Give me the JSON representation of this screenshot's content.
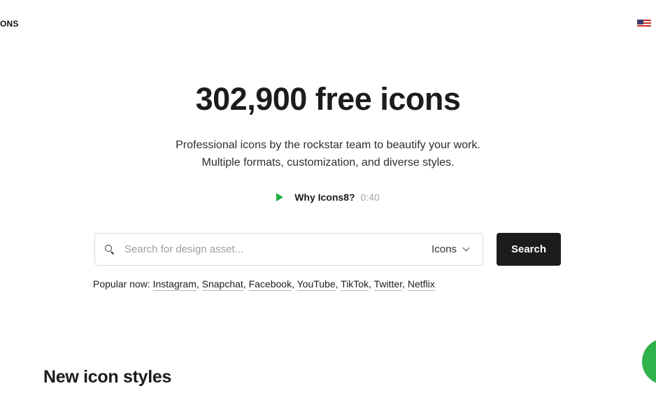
{
  "header": {
    "logo_text": "ONS",
    "language_flag": "us-flag-icon"
  },
  "hero": {
    "title": "302,900 free icons",
    "subtitle_line1": "Professional icons by the rockstar team to beautify your work.",
    "subtitle_line2": "Multiple formats, customization, and diverse styles.",
    "video_label": "Why Icons8?",
    "video_duration": "0:40"
  },
  "search": {
    "placeholder": "Search for design asset...",
    "type_selected": "Icons",
    "button_label": "Search"
  },
  "popular": {
    "prefix": "Popular now:",
    "items": [
      "Instagram",
      "Snapchat",
      "Facebook",
      "YouTube",
      "TikTok",
      "Twitter",
      "Netflix"
    ]
  },
  "sections": {
    "new_styles_heading": "New icon styles"
  },
  "colors": {
    "accent_green": "#1fb141",
    "button_dark": "#1c1c1c"
  }
}
